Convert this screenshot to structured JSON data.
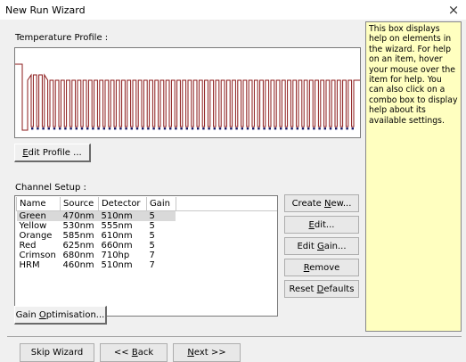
{
  "window": {
    "title": "New Run Wizard",
    "close_symbol": "×"
  },
  "temperature_profile": {
    "label": "Temperature Profile :",
    "edit_button": {
      "label": "Edit Profile ...",
      "accel": "E"
    }
  },
  "channel_setup": {
    "label": "Channel Setup :",
    "columns": [
      "Name",
      "Source",
      "Detector",
      "Gain"
    ],
    "rows": [
      [
        "Green",
        "470nm",
        "510nm",
        "5"
      ],
      [
        "Yellow",
        "530nm",
        "555nm",
        "5"
      ],
      [
        "Orange",
        "585nm",
        "610nm",
        "5"
      ],
      [
        "Red",
        "625nm",
        "660nm",
        "5"
      ],
      [
        "Crimson",
        "680nm",
        "710hp",
        "7"
      ],
      [
        "HRM",
        "460nm",
        "510nm",
        "7"
      ]
    ],
    "buttons": {
      "create_new": {
        "label": "Create New...",
        "accel": "N"
      },
      "edit": {
        "label": "Edit...",
        "accel": "E"
      },
      "edit_gain": {
        "label": "Edit Gain...",
        "accel": "G"
      },
      "remove": {
        "label": "Remove",
        "accel": "R"
      },
      "reset_defaults": {
        "label": "Reset Defaults",
        "accel": "D"
      }
    },
    "gain_optimisation_button": {
      "label": "Gain Optimisation...",
      "accel": "O"
    }
  },
  "help_panel": {
    "text": "This box displays help on elements in the wizard. For help on an item, hover your mouse over the item for help. You can also click on a combo box to display help about its available settings."
  },
  "footer": {
    "skip_wizard": {
      "label": "Skip Wizard",
      "accel": ""
    },
    "back": {
      "label": "<< Back",
      "accel": "B"
    },
    "next": {
      "label": "Next >>",
      "accel": "N"
    }
  },
  "colors": {
    "profile_line": "#8b1a1a",
    "profile_markers": "#1a1a66",
    "help_background": "#ffffc0"
  }
}
